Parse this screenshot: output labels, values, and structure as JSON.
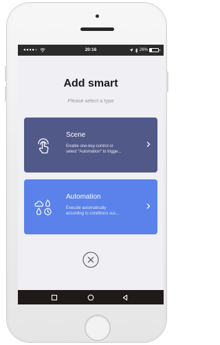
{
  "status_bar": {
    "signal": "●●●●○",
    "wifi_icon": "wifi-icon",
    "time": "20:16",
    "location_icon": "location-arrow-icon",
    "bluetooth_icon": "bluetooth-icon",
    "battery_text": "26%",
    "battery_level": 0.26
  },
  "header": {
    "title": "Add smart",
    "subtitle": "Please select a type"
  },
  "cards": [
    {
      "title": "Scene",
      "description_lines": [
        "Enable one-key-control or",
        "select \"Automation\" to trigge..."
      ],
      "icon": "touch-hand-icon",
      "color": "#515989"
    },
    {
      "title": "Automation",
      "description_lines": [
        "Execute automatically",
        "according to conditions suc..."
      ],
      "icon": "weather-time-conditions-icon",
      "color": "#5a82ea"
    }
  ],
  "close_icon": "close-circle-icon",
  "nav_bar": {
    "icons": [
      "recent-apps-square-icon",
      "home-circle-icon",
      "back-triangle-icon"
    ]
  }
}
